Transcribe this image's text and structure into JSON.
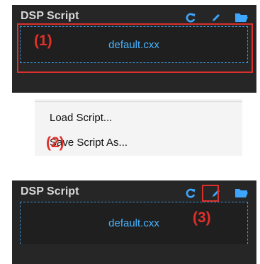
{
  "panel_top": {
    "title": "DSP Script",
    "script_name": "default.cxx"
  },
  "menu": {
    "items": [
      {
        "label": "Load Script..."
      },
      {
        "label": "Save Script As..."
      }
    ]
  },
  "panel_bottom": {
    "title": "DSP Script",
    "script_name": "default.cxx"
  },
  "annotations": {
    "one": "(1)",
    "two": "(2)",
    "three": "(3)"
  },
  "icons": {
    "reload": "reload-icon",
    "edit": "edit-icon",
    "folder": "folder-icon"
  },
  "colors": {
    "panel_bg": "#262626",
    "accent_blue": "#47b4ff",
    "annotation_red": "#e0302b"
  }
}
